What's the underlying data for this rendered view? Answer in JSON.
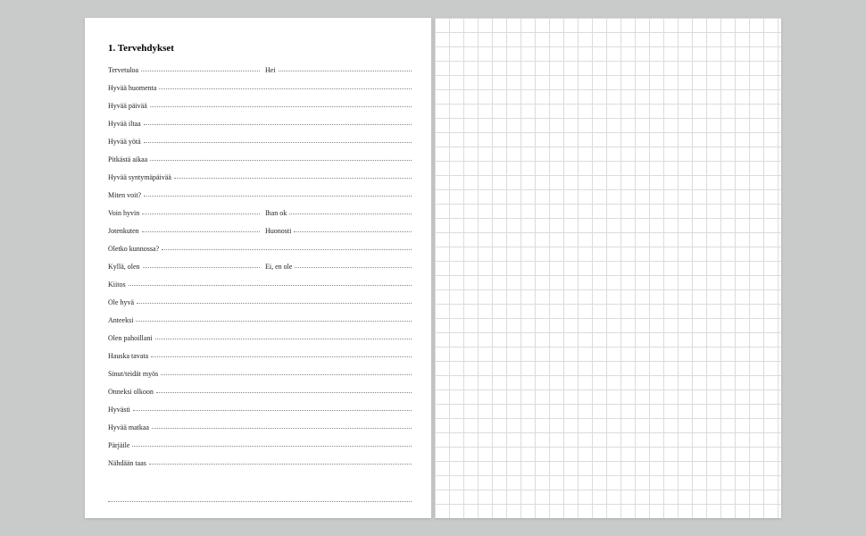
{
  "heading": "1. Tervehdykset",
  "rows": [
    {
      "type": "split",
      "left": "Tervetuloa",
      "right": "Hei"
    },
    {
      "type": "single",
      "text": "Hyvää huomenta"
    },
    {
      "type": "single",
      "text": "Hyvää päivää"
    },
    {
      "type": "single",
      "text": "Hyvää iltaa"
    },
    {
      "type": "single",
      "text": "Hyvää yötä"
    },
    {
      "type": "single",
      "text": "Pitkästä aikaa"
    },
    {
      "type": "single",
      "text": "Hyvää syntymäpäivää"
    },
    {
      "type": "single",
      "text": "Miten voit?"
    },
    {
      "type": "split",
      "left": "Voin hyvin",
      "right": "Ihan ok"
    },
    {
      "type": "split",
      "left": "Jotenkuten",
      "right": "Huonosti"
    },
    {
      "type": "single",
      "text": "Oletko kunnossa?"
    },
    {
      "type": "split",
      "left": "Kyllä, olen",
      "right": "Ei, en ole"
    },
    {
      "type": "single",
      "text": "Kiitos"
    },
    {
      "type": "single",
      "text": "Ole hyvä"
    },
    {
      "type": "single",
      "text": "Anteeksi"
    },
    {
      "type": "single",
      "text": "Olen pahoillani"
    },
    {
      "type": "single",
      "text": "Hauska tavata"
    },
    {
      "type": "single",
      "text": "Sinut/teidät myös"
    },
    {
      "type": "single",
      "text": "Onneksi olkoon"
    },
    {
      "type": "single",
      "text": "Hyvästi"
    },
    {
      "type": "single",
      "text": "Hyvää matkaa"
    },
    {
      "type": "single",
      "text": "Pärjäile"
    },
    {
      "type": "single",
      "text": "Nähdään taas"
    }
  ]
}
